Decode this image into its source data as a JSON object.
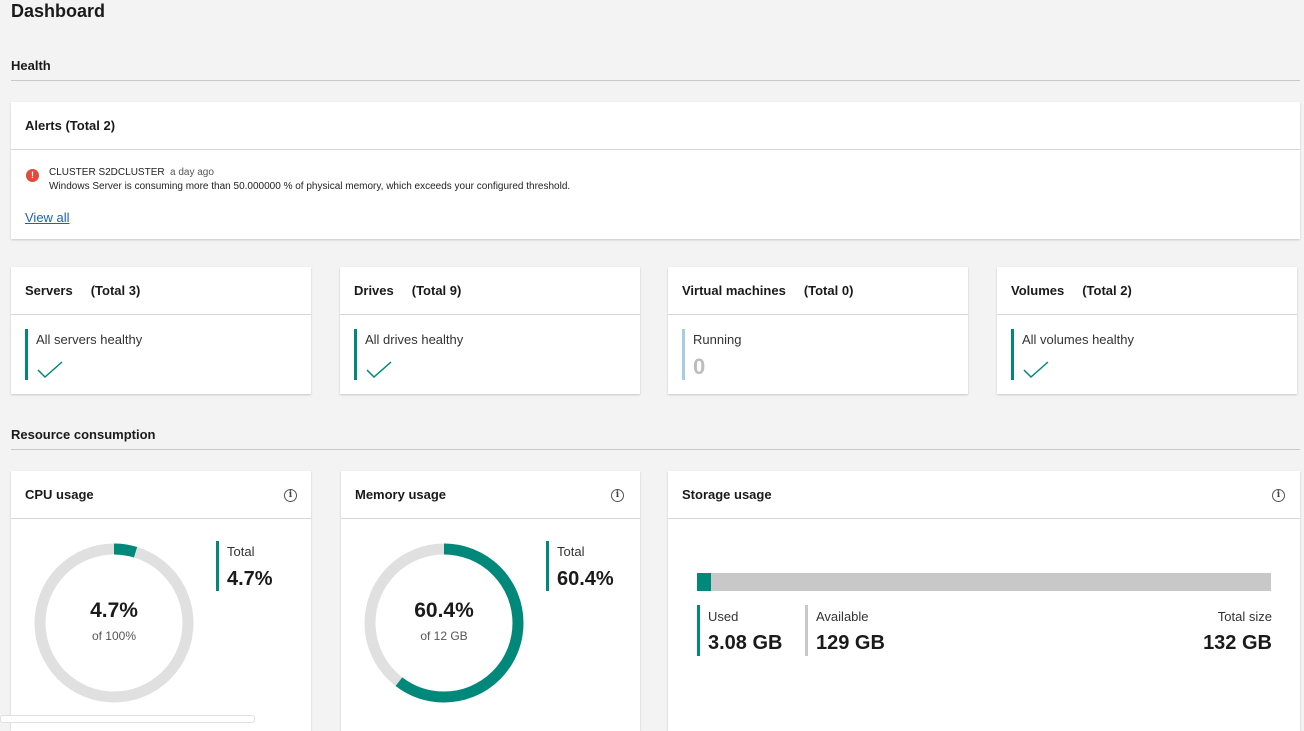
{
  "page": {
    "title": "Dashboard"
  },
  "health": {
    "section_title": "Health",
    "alerts": {
      "title": "Alerts (Total 2)",
      "items": [
        {
          "source": "CLUSTER S2DCLUSTER",
          "time": "a day ago",
          "message": "Windows Server is consuming more than 50.000000 % of physical memory, which exceeds your configured threshold.",
          "icon": "error-icon"
        }
      ],
      "view_all_label": "View all"
    },
    "cards": [
      {
        "title": "Servers",
        "total": "(Total 3)",
        "status": "All servers healthy",
        "icon": "check-icon"
      },
      {
        "title": "Drives",
        "total": "(Total 9)",
        "status": "All drives healthy",
        "icon": "check-icon"
      },
      {
        "title": "Virtual machines",
        "total": "(Total 0)",
        "status": "Running",
        "value": "0"
      },
      {
        "title": "Volumes",
        "total": "(Total 2)",
        "status": "All volumes healthy",
        "icon": "check-icon"
      }
    ]
  },
  "resources": {
    "section_title": "Resource consumption",
    "cpu": {
      "title": "CPU usage",
      "percent": 4.7,
      "center_value": "4.7%",
      "center_sub": "of 100%",
      "total_label": "Total",
      "total_value": "4.7%"
    },
    "memory": {
      "title": "Memory usage",
      "percent": 60.4,
      "center_value": "60.4%",
      "center_sub": "of 12 GB",
      "total_label": "Total",
      "total_value": "60.4%"
    },
    "storage": {
      "title": "Storage usage",
      "used_fraction": 0.0233,
      "used_label": "Used",
      "used_value": "3.08 GB",
      "available_label": "Available",
      "available_value": "129 GB",
      "total_label": "Total size",
      "total_value": "132 GB"
    }
  },
  "colors": {
    "accent": "#00897b",
    "track": "#e0e0e0",
    "error": "#e14b3b",
    "link": "#1a63b8"
  }
}
